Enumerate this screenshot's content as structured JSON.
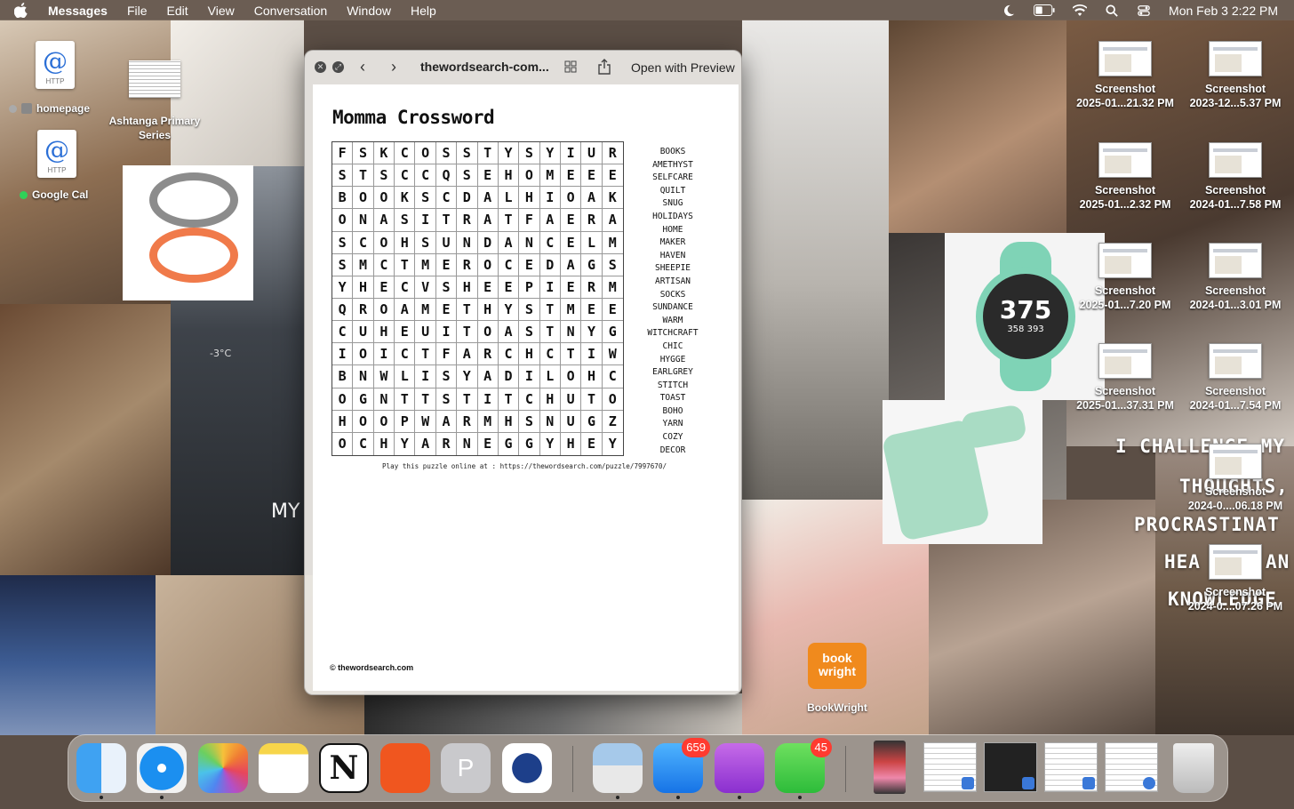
{
  "menubar": {
    "app": "Messages",
    "items": [
      "File",
      "Edit",
      "View",
      "Conversation",
      "Window",
      "Help"
    ],
    "clock": "Mon Feb 3  2:22 PM"
  },
  "desktop": {
    "icons": {
      "homepage": "homepage",
      "google_cal": "Google Cal",
      "ashtanga": "Ashtanga Primary Series",
      "http_label": "HTTP",
      "bookwright": "BookWright",
      "bookwright_tile": "book wright"
    },
    "screenshots": [
      {
        "title": "Screenshot",
        "sub": "2025-01...21.32 PM"
      },
      {
        "title": "Screenshot",
        "sub": "2023-12...5.37 PM"
      },
      {
        "title": "Screenshot",
        "sub": "2025-01...2.32 PM"
      },
      {
        "title": "Screenshot",
        "sub": "2024-01...7.58 PM"
      },
      {
        "title": "Screenshot",
        "sub": "2025-01...7.20 PM"
      },
      {
        "title": "Screenshot",
        "sub": "2024-01...3.01 PM"
      },
      {
        "title": "Screenshot",
        "sub": "2025-01...37.31 PM"
      },
      {
        "title": "Screenshot",
        "sub": "2024-01...7.54 PM"
      },
      {
        "title": "Screenshot",
        "sub": "2024-0....06.18 PM"
      },
      {
        "title": "Screenshot",
        "sub": "2024-0....07.26 PM"
      }
    ],
    "wall_text": {
      "temp": "-3°C",
      "my": "MY",
      "challenge": "I CHALLENGE MY",
      "thoughts": "THOUGHTS,",
      "procrastinat": "PROCRASTINAT",
      "hea": "HEA",
      "an": "AN",
      "knowledge": "KNOWLEDGE"
    },
    "watch": {
      "big": "375",
      "small": "358 393"
    }
  },
  "quicklook": {
    "title": "thewordsearch-com...",
    "open_with": "Open with Preview",
    "puzzle": {
      "title": "Momma Crossword",
      "grid": [
        "FSKCOSSTYSYIUR",
        "STSCCQSEHOMEEE",
        "BOOKSCDALHIOAK",
        "ONASITRATFAERA",
        "SCOHSUNDANCELM",
        "SMCTMEROCEDAGS",
        "YHECVSHEEPIERM",
        "QROAMETHYSTMEE",
        "CUHEUITOASTNYG",
        "IOICTFARCHCTIW",
        "BNWLISYADILOHC",
        "OGNTTSTITCHUTO",
        "HOOPWARMHSNUGZ",
        "OCHYARNEGGYHEY"
      ],
      "words": [
        "BOOKS",
        "AMETHYST",
        "SELFCARE",
        "QUILT",
        "SNUG",
        "HOLIDAYS",
        "HOME",
        "MAKER",
        "HAVEN",
        "SHEEPIE",
        "ARTISAN",
        "SOCKS",
        "SUNDANCE",
        "WARM",
        "WITCHCRAFT",
        "CHIC",
        "HYGGE",
        "EARLGREY",
        "STITCH",
        "TOAST",
        "BOHO",
        "YARN",
        "COZY",
        "DECOR"
      ],
      "url_line": "Play this puzzle online at : https://thewordsearch.com/puzzle/7997670/",
      "copyright": "© thewordsearch.com"
    }
  },
  "dock": {
    "mail_badge": "659",
    "messages_badge": "45",
    "presenter_letter": "P",
    "notion_letter": "N"
  },
  "colors": {
    "menubar": "#6e6056",
    "badge": "#ff3b30",
    "bookwright": "#f08a1d",
    "watch": "#7fd3b6"
  }
}
